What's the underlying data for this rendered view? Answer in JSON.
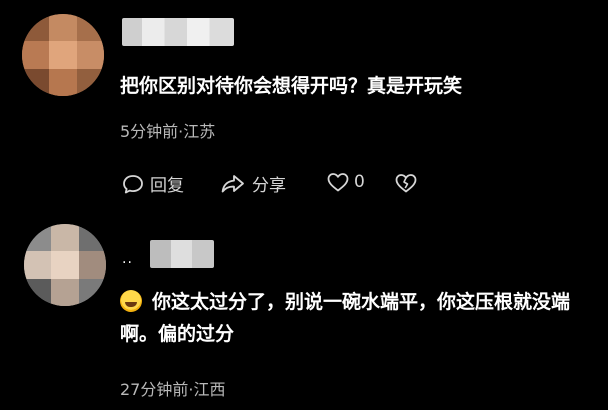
{
  "comments": [
    {
      "text": "把你区别对待你会想得开吗？真是开玩笑",
      "time_location": "5分钟前·江苏",
      "actions": {
        "reply_label": "回复",
        "share_label": "分享",
        "like_count": "0"
      }
    },
    {
      "name_prefix": "..",
      "text": "你这太过分了，别说一碗水端平，你这压根就没端啊。偏的过分",
      "time_location": "27分钟前·江西"
    }
  ],
  "icons": {
    "reply": "comment-bubble-icon",
    "share": "share-arrow-icon",
    "like": "heart-icon",
    "dislike": "broken-heart-icon",
    "emoji": "sweat-smile-emoji-icon"
  },
  "colors": {
    "background": "#000000",
    "text": "#ffffff",
    "meta": "#b9b9b9"
  }
}
